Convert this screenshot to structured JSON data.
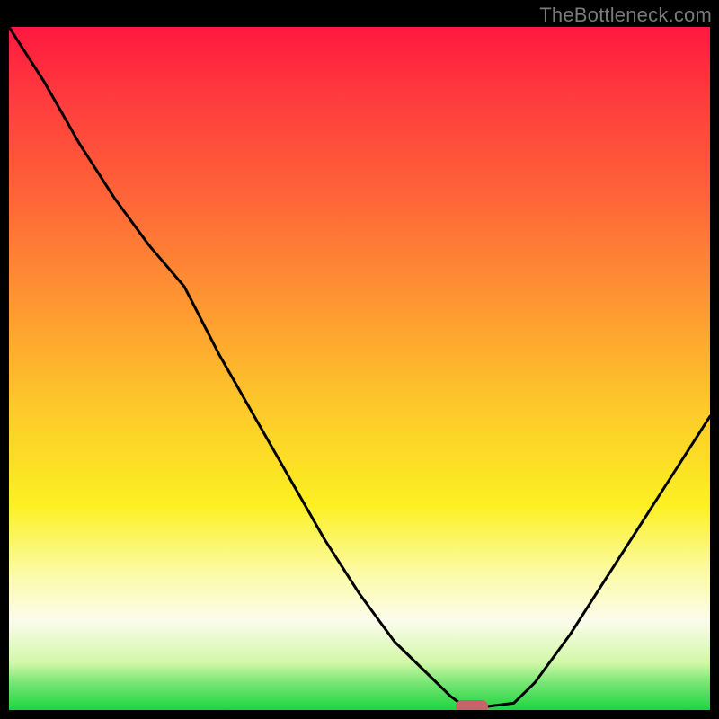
{
  "credit": "TheBottleneck.com",
  "colors": {
    "frame": "#000000",
    "curve": "#000000",
    "marker": "#c96169",
    "gradient_top": "#ff183f",
    "gradient_bottom": "#1cd540"
  },
  "chart_data": {
    "type": "line",
    "title": "",
    "xlabel": "",
    "ylabel": "",
    "xlim": [
      0,
      100
    ],
    "ylim": [
      0,
      100
    ],
    "x": [
      0,
      5,
      10,
      15,
      20,
      25,
      30,
      35,
      40,
      45,
      50,
      55,
      60,
      63,
      65,
      68,
      72,
      75,
      80,
      85,
      90,
      95,
      100
    ],
    "values": [
      100,
      92,
      83,
      75,
      68,
      62,
      52,
      43,
      34,
      25,
      17,
      10,
      5,
      2,
      0.5,
      0.5,
      1,
      4,
      11,
      19,
      27,
      35,
      43
    ],
    "marker": {
      "x": 66,
      "y": 0.5
    },
    "annotations": [],
    "legend": []
  }
}
